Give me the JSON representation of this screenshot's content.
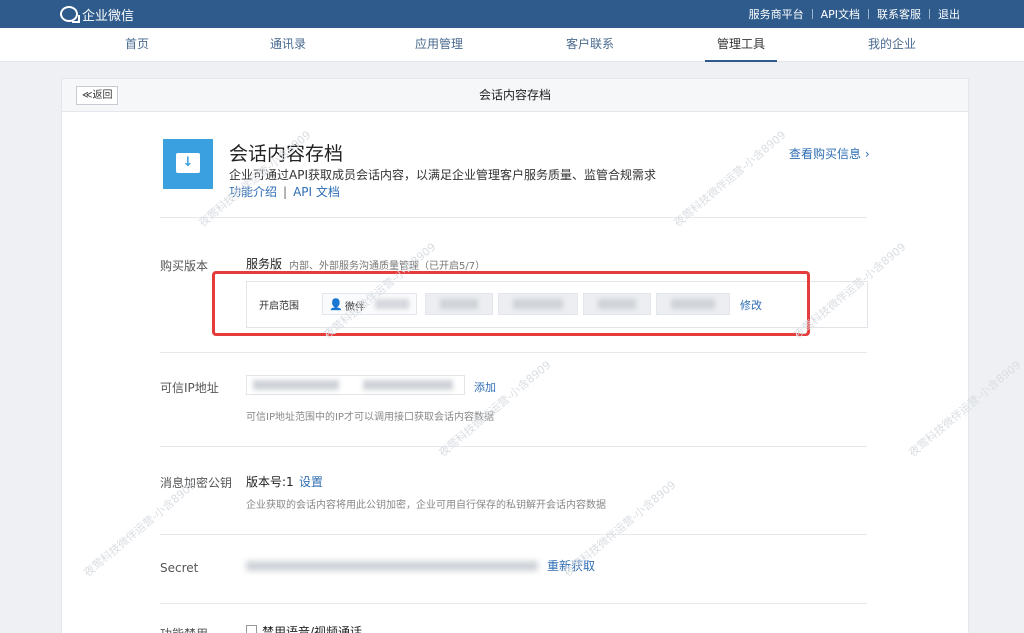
{
  "topbar": {
    "logo_text": "企业微信",
    "links": [
      "服务商平台",
      "API文档",
      "联系客服",
      "退出"
    ]
  },
  "nav": {
    "tabs": [
      "首页",
      "通讯录",
      "应用管理",
      "客户联系",
      "管理工具",
      "我的企业"
    ],
    "active": "管理工具"
  },
  "panel": {
    "back_label": "≪返回",
    "title": "会话内容存档"
  },
  "app": {
    "name": "会话内容存档",
    "description": "企业可通过API获取成员会话内容，以满足企业管理客户服务质量、监管合规需求",
    "intro_link": "功能介绍",
    "link_sep": "|",
    "api_link": "API 文档",
    "purchase_link": "查看购买信息 ›"
  },
  "version": {
    "label": "购买版本",
    "name": "服务版",
    "desc": "内部、外部服务沟通质量管理（已开启5/7）",
    "scope_label": "开启范围",
    "user_icon": "👤",
    "first_user": "微伴",
    "modify": "修改"
  },
  "trusted_ip": {
    "label": "可信IP地址",
    "add": "添加",
    "hint": "可信IP地址范围中的IP才可以调用接口获取会话内容数据"
  },
  "public_key": {
    "label": "消息加密公钥",
    "version": "版本号:1",
    "set": "设置",
    "hint": "企业获取的会话内容将用此公钥加密，企业可用自行保存的私钥解开会话内容数据"
  },
  "secret": {
    "label": "Secret",
    "refetch": "重新获取"
  },
  "disable": {
    "label": "功能禁用",
    "checkbox_label": "禁用语音/视频通话"
  },
  "watermark": "夜莺科技微伴运营-小含8909",
  "colors": {
    "topbar": "#2e5b8c",
    "link": "#2e6db4",
    "highlight": "#e63b3b",
    "app_icon": "#3ba0e0"
  }
}
